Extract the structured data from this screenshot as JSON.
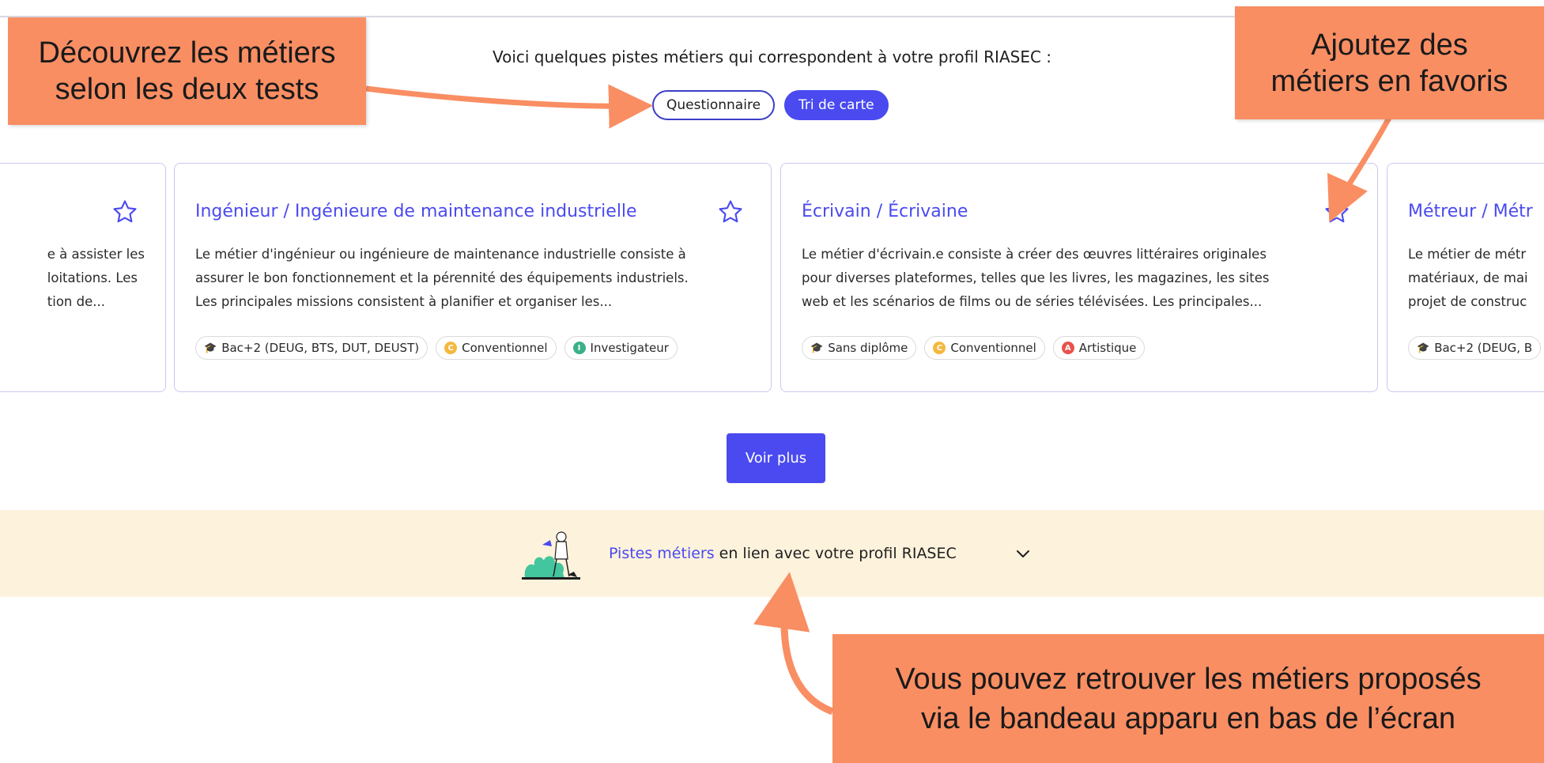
{
  "intro": {
    "text": "Voici quelques pistes métiers qui correspondent à votre profil RIASEC :"
  },
  "toggles": {
    "questionnaire": "Questionnaire",
    "tri_de_carte": "Tri de carte"
  },
  "cards": [
    {
      "title": "",
      "desc": [
        "e à assister les",
        "loitations. Les",
        "tion de..."
      ],
      "tags": []
    },
    {
      "title": "Ingénieur / Ingénieure de maintenance industrielle",
      "desc": [
        "Le métier d'ingénieur ou ingénieure de maintenance industrielle consiste à",
        "assurer le bon fonctionnement et la pérennité des équipements industriels.",
        "Les principales missions consistent à planifier et organiser les..."
      ],
      "tags": [
        {
          "label": "Bac+2 (DEUG, BTS, DUT, DEUST)",
          "icon": "graduation-cap-icon"
        },
        {
          "label": "Conventionnel",
          "letter": "C",
          "color": "#f5b83d"
        },
        {
          "label": "Investigateur",
          "letter": "I",
          "color": "#3bb08a"
        }
      ]
    },
    {
      "title": "Écrivain / Écrivaine",
      "desc": [
        "Le métier d'écrivain.e consiste à créer des œuvres littéraires originales",
        "pour diverses plateformes, telles que les livres, les magazines, les sites",
        "web et les scénarios de films ou de séries télévisées. Les principales..."
      ],
      "tags": [
        {
          "label": "Sans diplôme",
          "icon": "graduation-cap-icon"
        },
        {
          "label": "Conventionnel",
          "letter": "C",
          "color": "#f5b83d"
        },
        {
          "label": "Artistique",
          "letter": "A",
          "color": "#e8524a"
        }
      ]
    },
    {
      "title": "Métreur / Métr",
      "desc": [
        "Le métier de métr",
        "matériaux, de mai",
        "projet de construc"
      ],
      "tags": [
        {
          "label": "Bac+2 (DEUG, B",
          "icon": "graduation-cap-icon"
        }
      ]
    }
  ],
  "voir_plus": "Voir plus",
  "bandeau": {
    "link": "Pistes métiers",
    "rest": " en lien avec votre profil RIASEC"
  },
  "callouts": {
    "left": [
      "Découvrez les métiers",
      "selon les deux tests"
    ],
    "right": [
      "Ajoutez des",
      "métiers en favoris"
    ],
    "bottom": [
      "Vous pouvez retrouver les métiers proposés",
      "via le bandeau apparu en bas de l’écran"
    ]
  },
  "colors": {
    "accent": "#4a4af0",
    "callout": "#f98e63",
    "bandeau": "#fdf2dc"
  }
}
